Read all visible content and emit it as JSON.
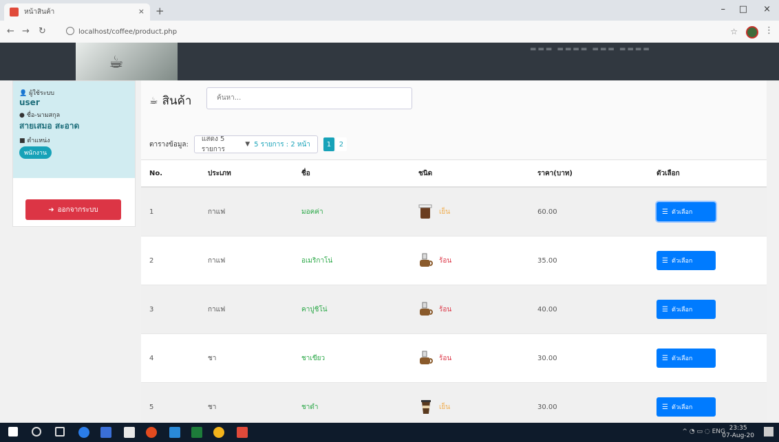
{
  "browser": {
    "tab_title": "หน้าสินค้า",
    "url": "localhost/coffee/product.php"
  },
  "sidebar": {
    "user_label": "ผู้ใช้ระบบ",
    "user_value": "user",
    "name_label": "ชื่อ-นามสกุล",
    "name_value": "สายเสมอ สะอาด",
    "position_label": "ตำแหน่ง",
    "position_value": "พนักงาน",
    "logout_label": "ออกจากระบบ"
  },
  "content": {
    "title": "สินค้า",
    "search_placeholder": "ค้นหา...",
    "rows_label": "ตารางข้อมูล:",
    "rows_select": "แสดง 5 รายการ",
    "page_info": "5 รายการ : 2 หน้า",
    "pages": [
      "1",
      "2"
    ],
    "active_page": "1",
    "columns": [
      "No.",
      "ประเภท",
      "ชื่อ",
      "ชนิด",
      "ราคา(บาท)",
      "ตัวเลือก"
    ],
    "rows": [
      {
        "no": "1",
        "category": "กาแฟ",
        "name": "มอคค่า",
        "type": "เย็น",
        "price": "60.00",
        "action": "ตัวเลือก"
      },
      {
        "no": "2",
        "category": "กาแฟ",
        "name": "อเมริกาโน่",
        "type": "ร้อน",
        "price": "35.00",
        "action": "ตัวเลือก"
      },
      {
        "no": "3",
        "category": "กาแฟ",
        "name": "คาปูชิโน่",
        "type": "ร้อน",
        "price": "40.00",
        "action": "ตัวเลือก"
      },
      {
        "no": "4",
        "category": "ชา",
        "name": "ชาเขียว",
        "type": "ร้อน",
        "price": "30.00",
        "action": "ตัวเลือก"
      },
      {
        "no": "5",
        "category": "ชา",
        "name": "ชาดำ",
        "type": "เย็น",
        "price": "30.00",
        "action": "ตัวเลือก"
      }
    ]
  },
  "taskbar": {
    "time": "23:35",
    "date": "07-Aug-20",
    "lang": "ENG"
  }
}
